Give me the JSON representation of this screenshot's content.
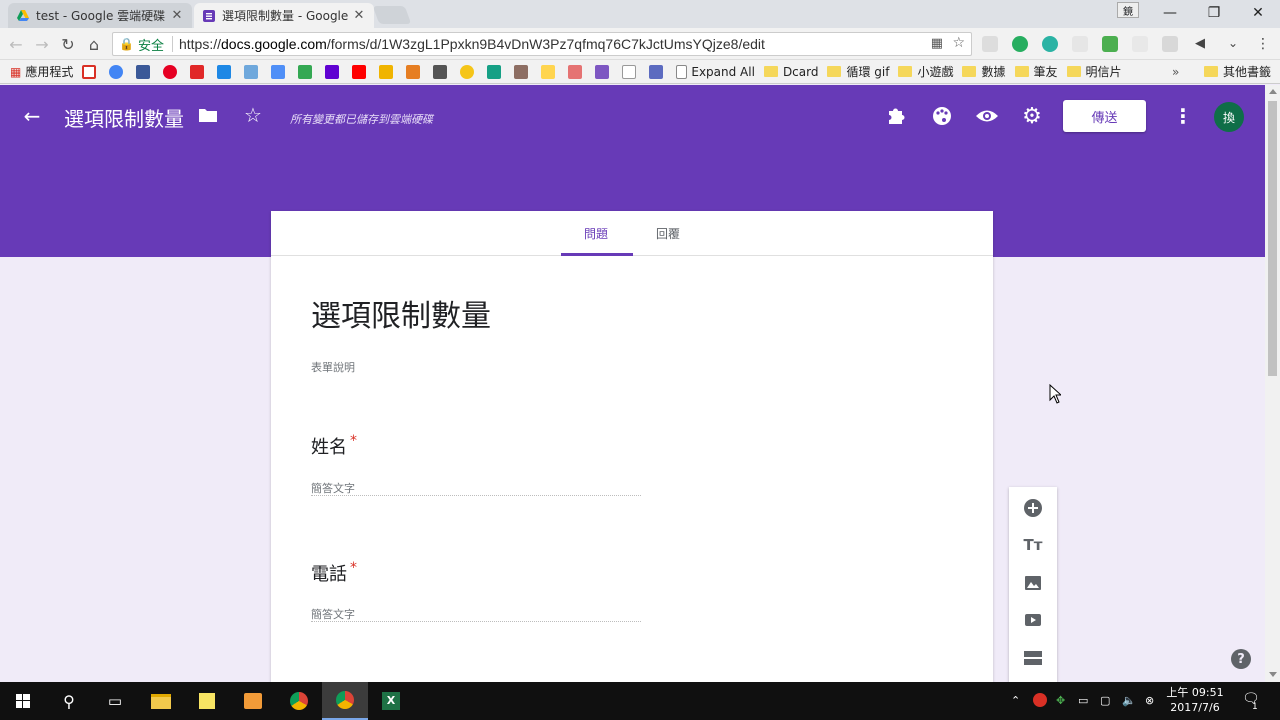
{
  "browser": {
    "tabs": [
      {
        "title": "test - Google 雲端硬碟"
      },
      {
        "title": "選項限制數量 - Google 表單"
      }
    ],
    "user_badge": "鏡",
    "omnibox": {
      "secure_label": "安全",
      "url_scheme": "https://",
      "url_host": "docs.google.com",
      "url_path": "/forms/d/1W3zgL1Ppxkn9B4vDnW3Pz7qfmq76C7kJctUmsYQjze8/edit"
    },
    "bookmarks": {
      "apps": "應用程式",
      "expand_all": "Expand All",
      "folders": [
        "Dcard",
        "循環 gif",
        "小遊戲",
        "數據",
        "筆友",
        "明信片"
      ],
      "other": "其他書籤"
    }
  },
  "form_header": {
    "title": "選項限制數量",
    "saved_message": "所有變更都已儲存到雲端硬碟",
    "send_label": "傳送",
    "avatar_letter": "換",
    "theme_color": "#673ab7"
  },
  "form": {
    "tabs": {
      "questions": "問題",
      "responses": "回覆"
    },
    "title": "選項限制數量",
    "description_placeholder": "表單說明",
    "questions": [
      {
        "label": "姓名",
        "required_mark": "*",
        "answer_placeholder": "簡答文字"
      },
      {
        "label": "電話",
        "required_mark": "*",
        "answer_placeholder": "簡答文字"
      }
    ]
  },
  "taskbar": {
    "time": "上午 09:51",
    "date": "2017/7/6",
    "notification_count": "1"
  }
}
